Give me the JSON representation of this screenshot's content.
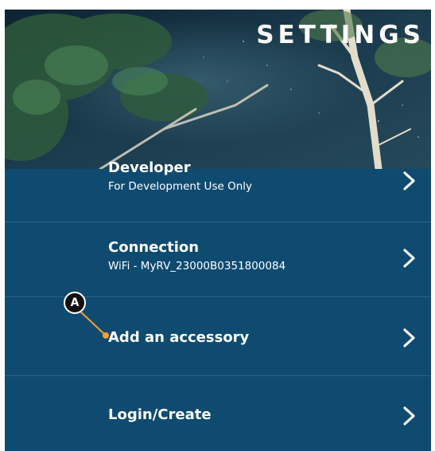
{
  "header": {
    "title": "SETTINGS"
  },
  "settings": {
    "items": [
      {
        "title": "Developer",
        "subtitle": "For Development Use Only"
      },
      {
        "title": "Connection",
        "subtitle": "WiFi - MyRV_23000B0351800084"
      },
      {
        "title": "Add an accessory",
        "subtitle": ""
      },
      {
        "title": "Login/Create",
        "subtitle": ""
      }
    ]
  },
  "annotation": {
    "label": "A",
    "color": "#f0a23a"
  },
  "colors": {
    "list_background": "#0f4b71",
    "divider": "#2a6388",
    "text": "#ffffff"
  },
  "icons": {
    "row_action": "chevron-right-icon"
  }
}
